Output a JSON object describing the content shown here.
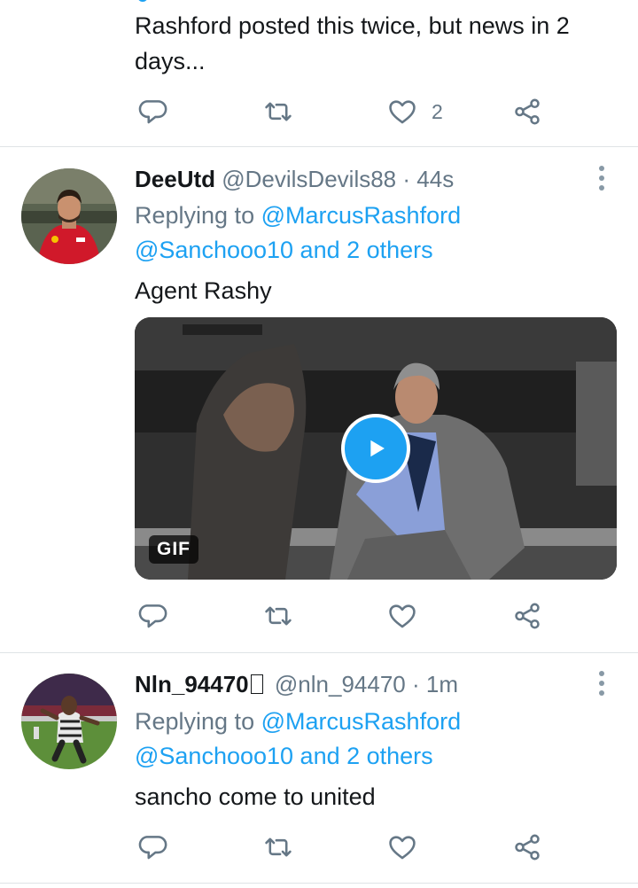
{
  "tweets": [
    {
      "text": "Rashford posted this twice, but news in 2 days...",
      "actions": {
        "like_count": "2"
      }
    },
    {
      "display_name": "DeeUtd",
      "handle": "@DevilsDevils88",
      "separator": "·",
      "time": "44s",
      "replying_prefix": "Replying to",
      "replying_mention": "@MarcusRashford",
      "replying_rest": "@Sanchooo10 and 2 others",
      "text": "Agent Rashy",
      "media": {
        "type": "gif",
        "badge": "GIF"
      }
    },
    {
      "display_name": "Nln_94470",
      "handle": "@nln_94470",
      "separator": "·",
      "time": "1m",
      "replying_prefix": "Replying to",
      "replying_mention": "@MarcusRashford",
      "replying_rest": "@Sanchooo10 and 2 others",
      "text": "sancho come to united"
    }
  ],
  "colors": {
    "link": "#1da1f2",
    "secondary_text": "#657786",
    "primary_text": "#14171a",
    "divider": "#dfe3e6"
  },
  "icons": [
    "reply-icon",
    "retweet-icon",
    "like-icon",
    "share-icon",
    "more-icon",
    "play-icon"
  ]
}
